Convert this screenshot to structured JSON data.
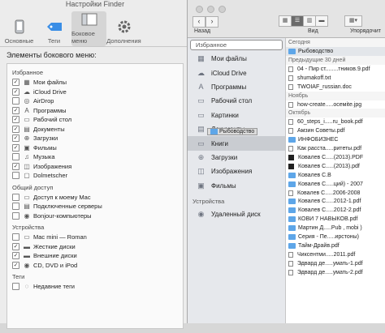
{
  "prefs": {
    "title": "Настройки Finder",
    "tabs": [
      {
        "label": "Основные",
        "icon": "phone-icon"
      },
      {
        "label": "Теги",
        "icon": "tag-icon"
      },
      {
        "label": "Боковое меню",
        "icon": "sidebar-icon"
      },
      {
        "label": "Дополнения",
        "icon": "gear-icon"
      }
    ],
    "heading": "Элементы бокового меню:",
    "groups": [
      {
        "title": "Избранное",
        "items": [
          {
            "label": "Мои файлы",
            "checked": true,
            "icon": "▦"
          },
          {
            "label": "iCloud Drive",
            "checked": true,
            "icon": "☁"
          },
          {
            "label": "AirDrop",
            "checked": false,
            "icon": "◎"
          },
          {
            "label": "Программы",
            "checked": true,
            "icon": "A"
          },
          {
            "label": "Рабочий стол",
            "checked": true,
            "icon": "▭"
          },
          {
            "label": "Документы",
            "checked": true,
            "icon": "▤"
          },
          {
            "label": "Загрузки",
            "checked": true,
            "icon": "⊕"
          },
          {
            "label": "Фильмы",
            "checked": true,
            "icon": "▣"
          },
          {
            "label": "Музыка",
            "checked": false,
            "icon": "♫"
          },
          {
            "label": "Изображения",
            "checked": true,
            "icon": "◫"
          },
          {
            "label": "Dolmetscher",
            "checked": false,
            "icon": "▢"
          }
        ]
      },
      {
        "title": "Общий доступ",
        "items": [
          {
            "label": "Доступ к моему Mac",
            "checked": false,
            "icon": "▭"
          },
          {
            "label": "Подключенные серверы",
            "checked": false,
            "icon": "▤"
          },
          {
            "label": "Bonjour-компьютеры",
            "checked": false,
            "icon": "◉"
          }
        ]
      },
      {
        "title": "Устройства",
        "items": [
          {
            "label": "Mac mini — Roman",
            "checked": false,
            "icon": "▭"
          },
          {
            "label": "Жесткие диски",
            "checked": true,
            "icon": "▬"
          },
          {
            "label": "Внешние диски",
            "checked": true,
            "icon": "▬"
          },
          {
            "label": "CD, DVD и iPod",
            "checked": true,
            "icon": "◉"
          }
        ]
      },
      {
        "title": "Теги",
        "items": [
          {
            "label": "Недавние теги",
            "checked": false,
            "icon": "◌"
          }
        ]
      }
    ]
  },
  "finder": {
    "toolbar": {
      "back_label": "Назад",
      "view_label": "Вид",
      "sort_label": "Упорядочит"
    },
    "sidebar": {
      "favorites_title": "Избранное",
      "favorites": [
        {
          "label": "Мои файлы",
          "icon": "▦"
        },
        {
          "label": "iCloud Drive",
          "icon": "☁"
        },
        {
          "label": "Программы",
          "icon": "A"
        },
        {
          "label": "Рабочий стол",
          "icon": "▭"
        },
        {
          "label": "Картинки",
          "icon": "▭"
        },
        {
          "label": "Документы",
          "icon": "▤"
        },
        {
          "label": "Книги",
          "icon": "▭"
        },
        {
          "label": "Загрузки",
          "icon": "⊕"
        },
        {
          "label": "Изображения",
          "icon": "◫"
        },
        {
          "label": "Фильмы",
          "icon": "▣"
        }
      ],
      "devices_title": "Устройства",
      "devices": [
        {
          "label": "Удаленный диск",
          "icon": "◉"
        }
      ],
      "drag_label": "Рыбоводство"
    },
    "files": [
      {
        "type": "section",
        "label": "Сегодня"
      },
      {
        "type": "folder",
        "label": "Рыбоводство",
        "selected": true
      },
      {
        "type": "section",
        "label": "Предыдущие 30 дней"
      },
      {
        "type": "doc",
        "label": "04 - Пир ст........тников.9.pdf"
      },
      {
        "type": "doc",
        "label": "shumakoff.txt"
      },
      {
        "type": "doc",
        "label": "TWOIAF_russian.doc"
      },
      {
        "type": "section",
        "label": "Ноябрь"
      },
      {
        "type": "doc",
        "label": "how-create.....осемite.jpg"
      },
      {
        "type": "section",
        "label": "Октябрь"
      },
      {
        "type": "doc",
        "label": "60_steps_i.....ru_book.pdf"
      },
      {
        "type": "doc",
        "label": "Амзин Советы.pdf"
      },
      {
        "type": "folder",
        "label": "ИНФОБИЗНЕС"
      },
      {
        "type": "doc",
        "label": "Как расста.....ритеты.pdf"
      },
      {
        "type": "img",
        "label": "Ковалев С.....(2013).PDF"
      },
      {
        "type": "img",
        "label": "Ковалев С.....(2013).pdf"
      },
      {
        "type": "folder",
        "label": "Ковалев С.В"
      },
      {
        "type": "folder",
        "label": "Ковалев С.....ций) - 2007"
      },
      {
        "type": "doc",
        "label": "Ковалев С.....2006-2008"
      },
      {
        "type": "folder",
        "label": "Ковалев С.....2012-1.pdf"
      },
      {
        "type": "folder",
        "label": "Ковалев С.....2012-2.pdf"
      },
      {
        "type": "folder",
        "label": "КОВИ 7 НАВЫКОВ.pdf"
      },
      {
        "type": "folder",
        "label": "Мартин Д.....Pub , mobi )"
      },
      {
        "type": "folder",
        "label": "Серия - Пе.....ирстоны)"
      },
      {
        "type": "folder",
        "label": "Тайм-Драйв.pdf"
      },
      {
        "type": "doc",
        "label": "Чиксентми.....2011.pdf"
      },
      {
        "type": "doc",
        "label": "Эдвард де.....умать-1.pdf"
      },
      {
        "type": "doc",
        "label": "Эдвард де.....умать-2.pdf"
      }
    ]
  }
}
